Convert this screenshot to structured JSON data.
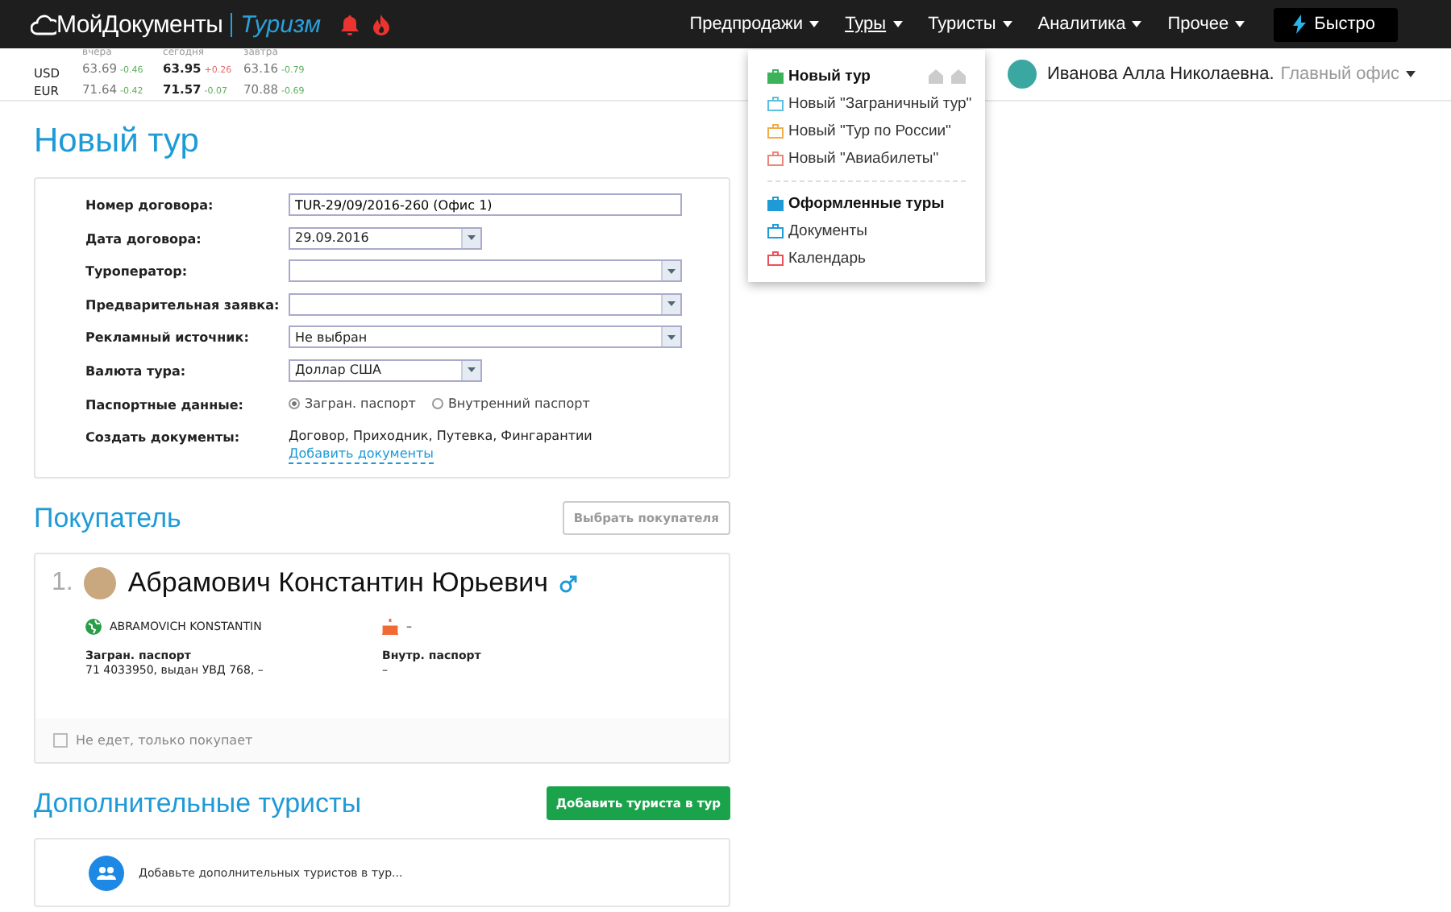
{
  "header": {
    "logo": {
      "brand": "МойДокументы",
      "product": "Туризм"
    },
    "nav": [
      {
        "label": "Предпродажи",
        "selected": false
      },
      {
        "label": "Туры",
        "selected": true
      },
      {
        "label": "Туристы",
        "selected": false
      },
      {
        "label": "Аналитика",
        "selected": false
      },
      {
        "label": "Прочее",
        "selected": false
      }
    ],
    "quick_button": "Быстро"
  },
  "rates": {
    "currencies": [
      "USD",
      "EUR"
    ],
    "columns": [
      {
        "label": "вчера",
        "current": false,
        "rows": [
          {
            "value": "63.69",
            "change": "-0.46",
            "color": "#5cae5c"
          },
          {
            "value": "71.64",
            "change": "-0.42",
            "color": "#5cae5c"
          }
        ]
      },
      {
        "label": "сегодня",
        "current": true,
        "rows": [
          {
            "value": "63.95",
            "change": "+0.26",
            "color": "#e06a6a"
          },
          {
            "value": "71.57",
            "change": "-0.07",
            "color": "#5cae5c"
          }
        ]
      },
      {
        "label": "завтра",
        "current": false,
        "rows": [
          {
            "value": "63.16",
            "change": "-0.79",
            "color": "#5cae5c"
          },
          {
            "value": "70.88",
            "change": "-0.69",
            "color": "#5cae5c"
          }
        ]
      }
    ]
  },
  "user": {
    "name": "Иванова Алла Николаевна.",
    "office": "Главный офис"
  },
  "menu": {
    "groups": [
      [
        {
          "label": "Новый тур",
          "kind": "heading",
          "color": "#3cb35a"
        },
        {
          "label": "Новый \"Заграничный тур\"",
          "kind": "link",
          "color": "#5bc0de"
        },
        {
          "label": "Новый \"Тур по России\"",
          "kind": "link",
          "color": "#f0ad4e"
        },
        {
          "label": "Новый \"Авиабилеты\"",
          "kind": "link",
          "color": "#e8887a"
        }
      ],
      [
        {
          "label": "Оформленные туры",
          "kind": "heading",
          "color": "#1e9bd7"
        },
        {
          "label": "Документы",
          "kind": "link",
          "color": "#1e9bd7"
        },
        {
          "label": "Календарь",
          "kind": "link",
          "color": "#e9505a"
        }
      ]
    ]
  },
  "page_title": "Новый тур",
  "form": [
    {
      "label": "Номер договора:",
      "kind": "text",
      "value": "TUR-29/09/2016-260 (Офис 1)"
    },
    {
      "label": "Дата договора:",
      "kind": "short-select",
      "value": "29.09.2016"
    },
    {
      "label": "Туроператор:",
      "kind": "select"
    },
    {
      "label": "Предварительная заявка:",
      "kind": "select"
    },
    {
      "label": "Рекламный источник:",
      "kind": "select",
      "value": "Не выбран"
    },
    {
      "label": "Валюта тура:",
      "kind": "short-select",
      "value": "Доллар США"
    },
    {
      "label": "Паспортные данные:",
      "kind": "radio",
      "options": [
        {
          "label": "Загран. паспорт",
          "selected": true
        },
        {
          "label": "Внутренний паспорт",
          "selected": false
        }
      ]
    },
    {
      "label": "Создать документы:",
      "kind": "documents",
      "value": "Договор, Приходник, Путевка, Фингарантии",
      "link": "Добавить документы"
    }
  ],
  "buyer": {
    "title": "Покупатель",
    "button": "Выбрать покупателя",
    "number": "1.",
    "name": "Абрамович Константин Юрьевич",
    "latin_name": "ABRAMOVICH KONSTANTIN",
    "birth_date": "–",
    "passports": [
      {
        "label": "Загран. паспорт",
        "value": "71 4033950, выдан УВД 768, –"
      },
      {
        "label": "Внутр. паспорт",
        "value": "–"
      }
    ],
    "not_travelling": {
      "label": "Не едет, только покупает",
      "checked": false
    }
  },
  "extra": {
    "title": "Дополнительные туристы",
    "button": "Добавить туриста в тур",
    "hint": "Добавьте дополнительных туристов в тур..."
  }
}
